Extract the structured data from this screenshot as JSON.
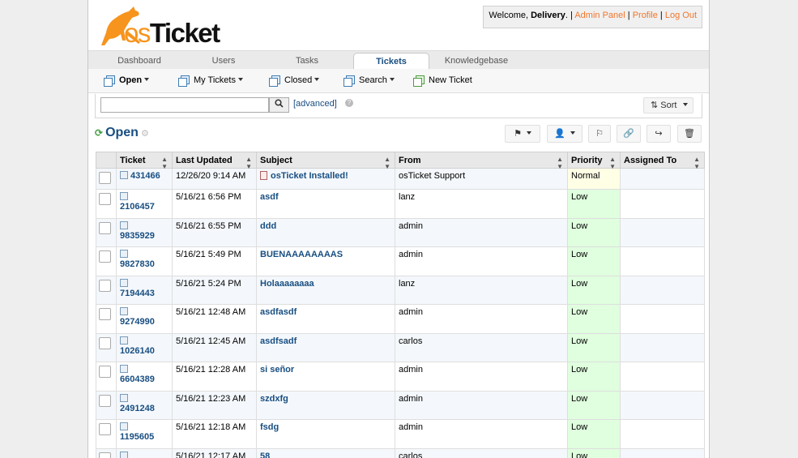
{
  "header": {
    "logo_text": "osTicket",
    "welcome_prefix": "Welcome, ",
    "user_name": "Delivery",
    "separator": ". | ",
    "admin_panel": "Admin Panel",
    "profile": "Profile",
    "logout": "Log Out"
  },
  "nav": {
    "tabs": [
      {
        "label": "Dashboard"
      },
      {
        "label": "Users"
      },
      {
        "label": "Tasks"
      },
      {
        "label": "Tickets"
      },
      {
        "label": "Knowledgebase"
      }
    ],
    "active": "Tickets"
  },
  "subnav": {
    "open": "Open",
    "my_tickets": "My Tickets",
    "closed": "Closed",
    "search": "Search",
    "new_ticket": "New Ticket"
  },
  "search": {
    "value": "",
    "advanced": "[advanced]",
    "sort": "Sort"
  },
  "queue": {
    "title": "Open"
  },
  "table": {
    "headers": [
      "Ticket",
      "Last Updated",
      "Subject",
      "From",
      "Priority",
      "Assigned To"
    ],
    "rows": [
      {
        "number": "431466",
        "updated": "12/26/20 9:14 AM",
        "subject": "osTicket Installed!",
        "from": "osTicket Support",
        "priority": "Normal",
        "assigned": ""
      },
      {
        "number": "2106457",
        "updated": "5/16/21 6:56 PM",
        "subject": "asdf",
        "from": "lanz",
        "priority": "Low",
        "assigned": ""
      },
      {
        "number": "9835929",
        "updated": "5/16/21 6:55 PM",
        "subject": "ddd",
        "from": "admin",
        "priority": "Low",
        "assigned": ""
      },
      {
        "number": "9827830",
        "updated": "5/16/21 5:49 PM",
        "subject": "BUENAAAAAAAAS",
        "from": "admin",
        "priority": "Low",
        "assigned": ""
      },
      {
        "number": "7194443",
        "updated": "5/16/21 5:24 PM",
        "subject": "Holaaaaaaaa",
        "from": "lanz",
        "priority": "Low",
        "assigned": ""
      },
      {
        "number": "9274990",
        "updated": "5/16/21 12:48 AM",
        "subject": "asdfasdf",
        "from": "admin",
        "priority": "Low",
        "assigned": ""
      },
      {
        "number": "1026140",
        "updated": "5/16/21 12:45 AM",
        "subject": "asdfsadf",
        "from": "carlos",
        "priority": "Low",
        "assigned": ""
      },
      {
        "number": "6604389",
        "updated": "5/16/21 12:28 AM",
        "subject": "si señor",
        "from": "admin",
        "priority": "Low",
        "assigned": ""
      },
      {
        "number": "2491248",
        "updated": "5/16/21 12:23 AM",
        "subject": "szdxfg",
        "from": "admin",
        "priority": "Low",
        "assigned": ""
      },
      {
        "number": "1195605",
        "updated": "5/16/21 12:18 AM",
        "subject": "fsdg",
        "from": "admin",
        "priority": "Low",
        "assigned": ""
      },
      {
        "number": "",
        "updated": "5/16/21 12:17 AM",
        "subject": "58",
        "from": "carlos",
        "priority": "Low",
        "assigned": ""
      }
    ]
  },
  "colors": {
    "brand": "#f7941d",
    "link": "#184e81",
    "header_link": "#f0762d",
    "priority_low": "#dfffde",
    "priority_normal": "#ffffe6"
  }
}
